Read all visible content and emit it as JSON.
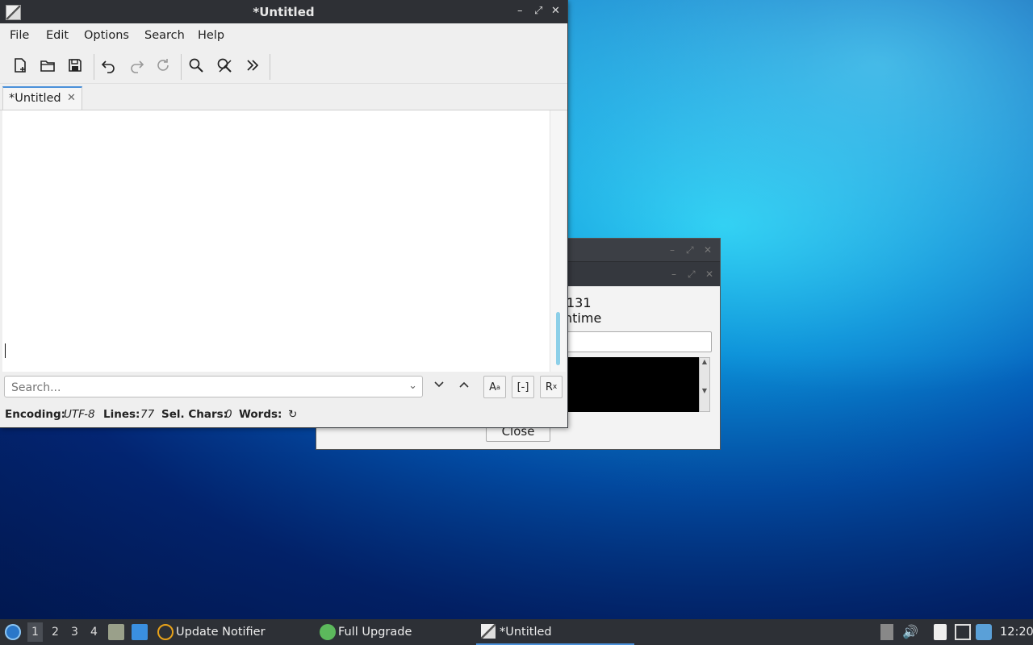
{
  "window": {
    "title": "*Untitled",
    "controls": {
      "minimize": "–",
      "maximize": "⤢",
      "close": "✕"
    }
  },
  "menubar": [
    "File",
    "Edit",
    "Options",
    "Search",
    "Help"
  ],
  "toolbar": {
    "buttons": [
      "new-document",
      "open-folder",
      "save",
      "undo",
      "redo",
      "reload",
      "find",
      "replace",
      "more"
    ]
  },
  "tab": {
    "label": "*Untitled",
    "close": "✕"
  },
  "search": {
    "placeholder": "Search...",
    "dropdown": "⌄",
    "next": "⌄",
    "prev": "⌃",
    "match_case": "A",
    "whole_word": "[-]",
    "regex": "R"
  },
  "status": {
    "encoding_label": "Encoding:",
    "encoding_value": "UTF-8",
    "lines_label": "Lines:",
    "lines_value": "77",
    "sel_label": "Sel. Chars:",
    "sel_value": "0",
    "words_label": "Words:",
    "refresh": "↻"
  },
  "background_dialog": {
    "line1": "131",
    "line2": "ntime",
    "close_label": "Close"
  },
  "taskbar": {
    "workspaces": [
      "1",
      "2",
      "3",
      "4"
    ],
    "tasks": [
      "Update Notifier",
      "Full Upgrade",
      "*Untitled"
    ],
    "clock": "12:20"
  },
  "colors": {
    "accent": "#4a90d9",
    "titlebar": "#2e3035",
    "taskbar": "#2d3036"
  }
}
